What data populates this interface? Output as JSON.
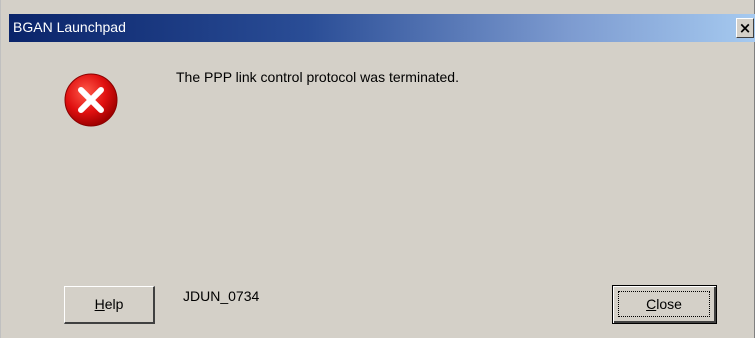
{
  "window": {
    "title": "BGAN Launchpad",
    "close_glyph": "×"
  },
  "dialog": {
    "icon": "error-icon",
    "icon_color": "#e01010",
    "message": "The PPP link control protocol was terminated.",
    "error_code": "JDUN_0734"
  },
  "buttons": {
    "help": {
      "mnemonic": "H",
      "rest": "elp"
    },
    "close": {
      "mnemonic": "C",
      "rest": "lose"
    }
  },
  "colors": {
    "titlebar_start": "#0a246a",
    "titlebar_end": "#a6caf0",
    "dialog_bg": "#d4d0c8"
  }
}
